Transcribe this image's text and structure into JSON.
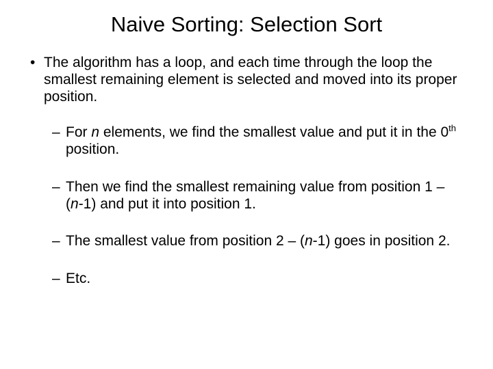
{
  "title": "Naive Sorting: Selection Sort",
  "bullets": {
    "main": "The algorithm has a loop, and each time through the loop the smallest remaining element is selected and moved into its proper position.",
    "sub": [
      {
        "pre": "For ",
        "n": "n",
        "mid": " elements, we find the smallest value and put it in the 0",
        "sup": "th",
        "post": " position."
      },
      {
        "pre": "Then we find the smallest remaining value from position 1 – (",
        "n": "n",
        "mid": "-1) and put it into position 1.",
        "sup": "",
        "post": ""
      },
      {
        "pre": "The smallest value from position 2 – (",
        "n": "n",
        "mid": "-1) goes in position 2.",
        "sup": "",
        "post": ""
      },
      {
        "pre": "Etc.",
        "n": "",
        "mid": "",
        "sup": "",
        "post": ""
      }
    ]
  }
}
